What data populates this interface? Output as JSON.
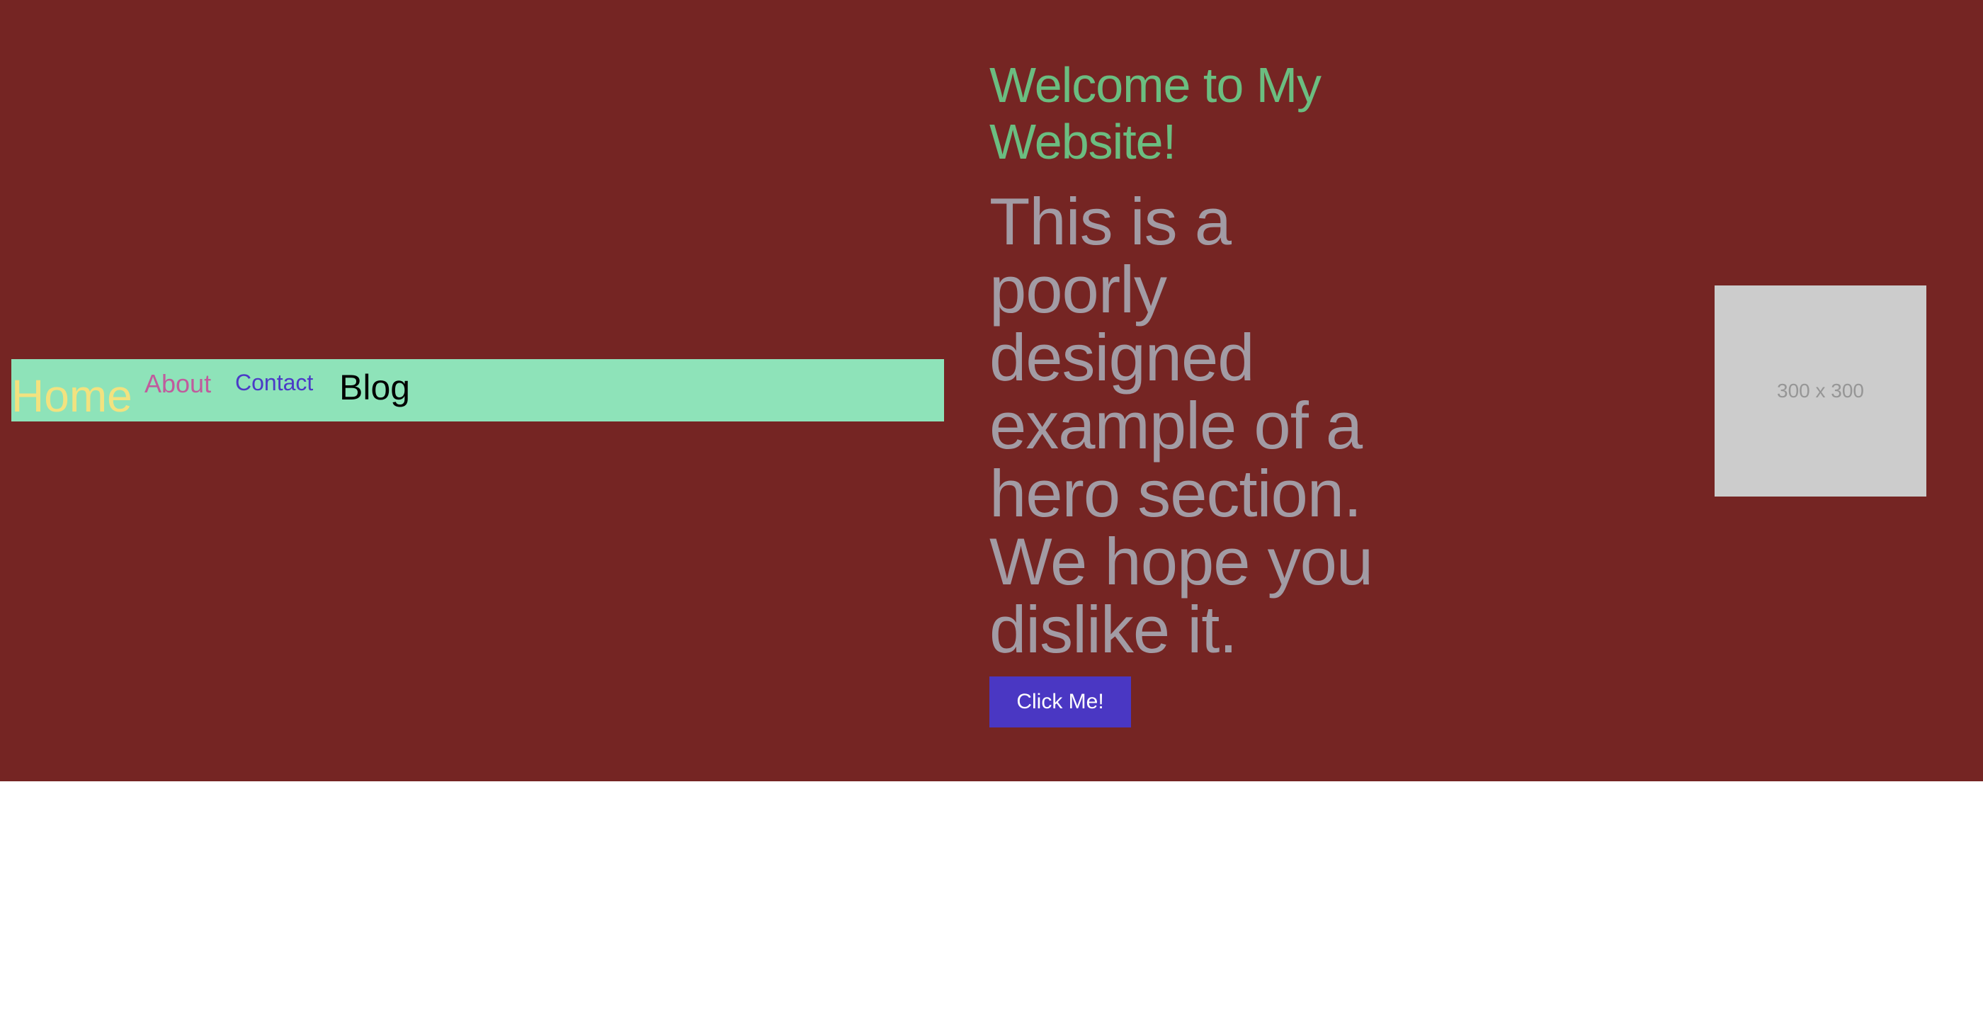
{
  "nav": {
    "items": [
      {
        "label": "Home",
        "color": "#f2e27f"
      },
      {
        "label": "About",
        "color": "#c05c9d"
      },
      {
        "label": "Contact",
        "color": "#4b3ac7"
      },
      {
        "label": "Blog",
        "color": "#000000"
      }
    ],
    "background": "#8ee3b9"
  },
  "hero": {
    "title": "Welcome to My Website!",
    "text": "This is a poorly designed example of a hero section. We hope you dislike it.",
    "button_label": "Click Me!",
    "image_placeholder_label": "300 x 300",
    "background": "#752523",
    "title_color": "#6bbd80",
    "text_color": "#a29ba4",
    "button_color": "#4a37c3"
  }
}
